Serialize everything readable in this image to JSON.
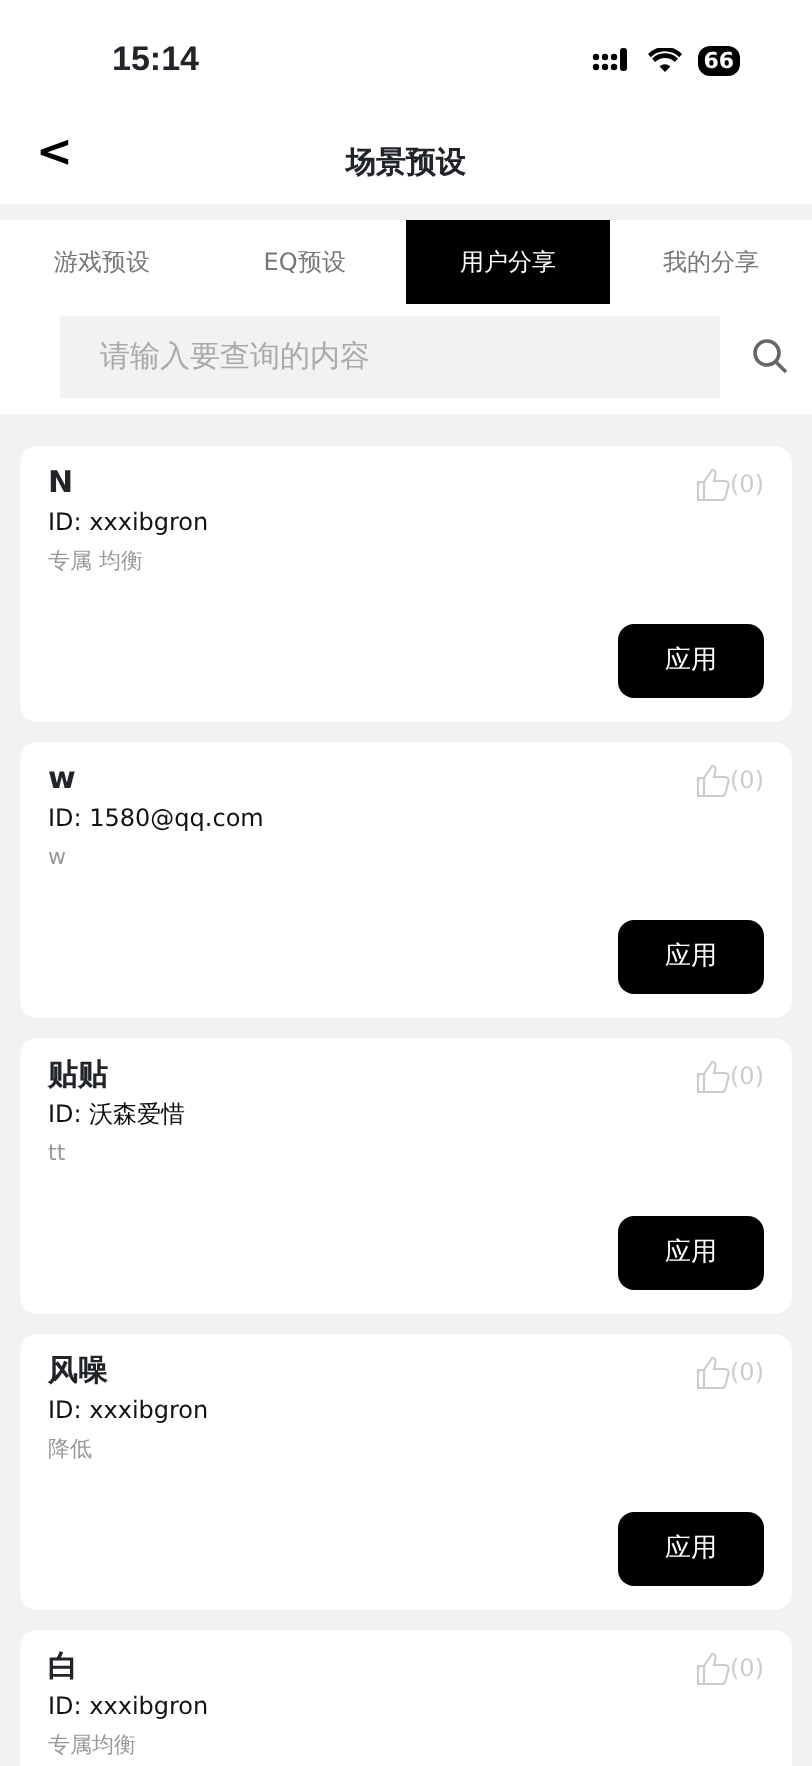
{
  "status_bar": {
    "time": "15:14",
    "battery": "66"
  },
  "header": {
    "back": "<",
    "title": "场景预设"
  },
  "tabs": [
    {
      "label": "游戏预设",
      "selected": false
    },
    {
      "label": "EQ预设",
      "selected": false
    },
    {
      "label": "用户分享",
      "selected": true
    },
    {
      "label": "我的分享",
      "selected": false
    }
  ],
  "search": {
    "placeholder": "请输入要查询的内容"
  },
  "presets": [
    {
      "name": "N",
      "id": "ID: xxxibgron",
      "description": "专属 均衡",
      "likes": "(0)",
      "action": "应用"
    },
    {
      "name": "w",
      "id": "ID: 1580@qq.com",
      "description": "w",
      "likes": "(0)",
      "action": "应用"
    },
    {
      "name": "贴贴",
      "id": "ID: 沃森爱惜",
      "description": "tt",
      "likes": "(0)",
      "action": "应用"
    },
    {
      "name": "风噪",
      "id": "ID: xxxibgron",
      "description": "降低",
      "likes": "(0)",
      "action": "应用"
    },
    {
      "name": "白",
      "id": "ID: xxxibgron",
      "description": "专属均衡",
      "likes": "(0)"
    }
  ]
}
